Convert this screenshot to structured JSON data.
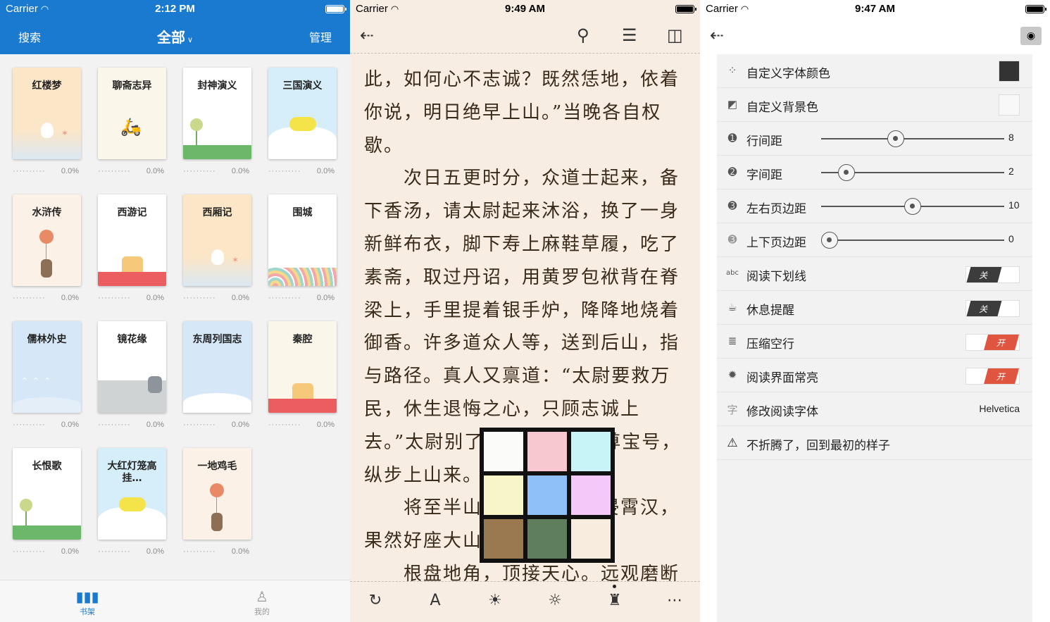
{
  "screen1": {
    "status": {
      "carrier": "Carrier",
      "time": "2:12 PM"
    },
    "nav": {
      "left": "搜索",
      "title": "全部",
      "right": "管理"
    },
    "books": [
      {
        "title": "红楼梦",
        "progress": "0.0%",
        "bg": "#fbe6c8",
        "scene": "goose"
      },
      {
        "title": "聊斋志异",
        "progress": "0.0%",
        "bg": "#fbf6ea",
        "scene": "scooter"
      },
      {
        "title": "封神演义",
        "progress": "0.0%",
        "bg": "#ffffff",
        "scene": "grass"
      },
      {
        "title": "三国演义",
        "progress": "0.0%",
        "bg": "#d6eefa",
        "scene": "sub"
      },
      {
        "title": "水浒传",
        "progress": "0.0%",
        "bg": "#fbf1e6",
        "scene": "bear"
      },
      {
        "title": "西游记",
        "progress": "0.0%",
        "bg": "#ffffff",
        "scene": "cake"
      },
      {
        "title": "西厢记",
        "progress": "0.0%",
        "bg": "#fbe6c8",
        "scene": "goose"
      },
      {
        "title": "围城",
        "progress": "0.0%",
        "bg": "#ffffff",
        "scene": "waves"
      },
      {
        "title": "儒林外史",
        "progress": "0.0%",
        "bg": "#d6e8f8",
        "scene": "birds"
      },
      {
        "title": "镜花缘",
        "progress": "0.0%",
        "bg": "#ffffff",
        "scene": "cat"
      },
      {
        "title": "东周列国志",
        "progress": "0.0%",
        "bg": "#d6e8f8",
        "scene": "cloud"
      },
      {
        "title": "秦腔",
        "progress": "0.0%",
        "bg": "#fbf6ea",
        "scene": "cake"
      },
      {
        "title": "长恨歌",
        "progress": "0.0%",
        "bg": "#ffffff",
        "scene": "grass"
      },
      {
        "title": "大红灯笼高挂…",
        "progress": "0.0%",
        "bg": "#d6eefa",
        "scene": "sub"
      },
      {
        "title": "一地鸡毛",
        "progress": "0.0%",
        "bg": "#fbf1e6",
        "scene": "bear"
      }
    ],
    "tabs": [
      {
        "label": "书架",
        "active": true
      },
      {
        "label": "我的",
        "active": false
      }
    ]
  },
  "screen2": {
    "status": {
      "carrier": "Carrier",
      "time": "9:49 AM"
    },
    "paragraphs": [
      "此，如何心不志诚？既然恁地，依着你说，明日绝早上山。”当晚各自权歇。",
      "　　次日五更时分，众道士起来，备下香汤，请太尉起来沐浴，换了一身新鲜布衣，脚下寿上麻鞋草履，吃了素斋，取过丹诏，用黄罗包袱背在脊梁上，手里提着银手炉，降降地烧着御香。许多道众人等，送到后山，指与路径。真人又禀道：“太尉要救万民，休生退悔之心，只顾志诚上去。”太尉别了众人，口诵天尊宝号，纵步上山来。",
      "　　将至半山，望见大顶直侵霄汉，果然好座大山！",
      "　　根盘地角，顶接天心。远观磨断"
    ],
    "palette": [
      "#fbfbf9",
      "#f8c8d0",
      "#c8f4f8",
      "#f8f6c8",
      "#90c0f8",
      "#f4c8f8",
      "#9a7850",
      "#5e7e5e",
      "#f8ecde"
    ]
  },
  "screen3": {
    "status": {
      "carrier": "Carrier",
      "time": "9:47 AM"
    },
    "rows": {
      "font_color": {
        "label": "自定义字体颜色",
        "color": "#333333"
      },
      "bg_color": {
        "label": "自定义背景色",
        "color": "#f8f8f8"
      },
      "line_spacing": {
        "label": "行间距",
        "value": "8"
      },
      "char_spacing": {
        "label": "字间距",
        "value": "2"
      },
      "lr_margin": {
        "label": "左右页边距",
        "value": "10"
      },
      "tb_margin": {
        "label": "上下页边距",
        "value": "0"
      },
      "underline": {
        "label": "阅读下划线",
        "state": "关"
      },
      "rest_reminder": {
        "label": "休息提醒",
        "state": "关"
      },
      "compress_lines": {
        "label": "压缩空行",
        "state": "开"
      },
      "keep_awake": {
        "label": "阅读界面常亮",
        "state": "开"
      },
      "font": {
        "label": "修改阅读字体",
        "value": "Helvetica"
      },
      "reset": {
        "label": "不折腾了，回到最初的样子"
      }
    }
  }
}
